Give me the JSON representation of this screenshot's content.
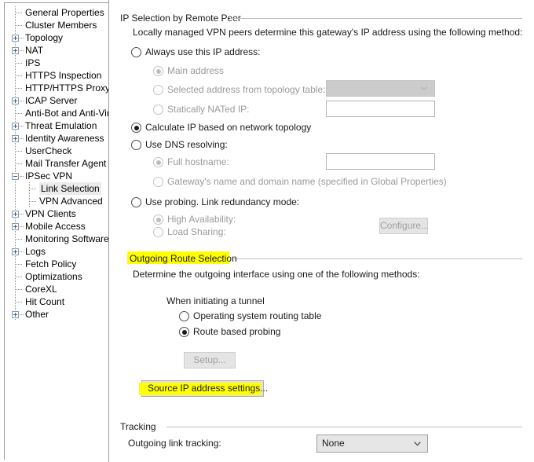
{
  "sidebar": {
    "items": [
      {
        "label": "General Properties",
        "indent": 0,
        "toggle": "none",
        "selected": false
      },
      {
        "label": "Cluster Members",
        "indent": 0,
        "toggle": "none",
        "selected": false
      },
      {
        "label": "Topology",
        "indent": 0,
        "toggle": "plus",
        "selected": false
      },
      {
        "label": "NAT",
        "indent": 0,
        "toggle": "plus",
        "selected": false
      },
      {
        "label": "IPS",
        "indent": 0,
        "toggle": "none",
        "selected": false
      },
      {
        "label": "HTTPS Inspection",
        "indent": 0,
        "toggle": "none",
        "selected": false
      },
      {
        "label": "HTTP/HTTPS Proxy",
        "indent": 0,
        "toggle": "none",
        "selected": false
      },
      {
        "label": "ICAP Server",
        "indent": 0,
        "toggle": "plus",
        "selected": false
      },
      {
        "label": "Anti-Bot and Anti-Virus",
        "indent": 0,
        "toggle": "none",
        "selected": false
      },
      {
        "label": "Threat Emulation",
        "indent": 0,
        "toggle": "plus",
        "selected": false
      },
      {
        "label": "Identity Awareness",
        "indent": 0,
        "toggle": "plus",
        "selected": false
      },
      {
        "label": "UserCheck",
        "indent": 0,
        "toggle": "none",
        "selected": false
      },
      {
        "label": "Mail Transfer Agent",
        "indent": 0,
        "toggle": "none",
        "selected": false
      },
      {
        "label": "IPSec VPN",
        "indent": 0,
        "toggle": "minus",
        "selected": false
      },
      {
        "label": "Link Selection",
        "indent": 1,
        "toggle": "none",
        "selected": true
      },
      {
        "label": "VPN Advanced",
        "indent": 1,
        "toggle": "none",
        "selected": false
      },
      {
        "label": "VPN Clients",
        "indent": 0,
        "toggle": "plus",
        "selected": false
      },
      {
        "label": "Mobile Access",
        "indent": 0,
        "toggle": "plus",
        "selected": false
      },
      {
        "label": "Monitoring Software bla",
        "indent": 0,
        "toggle": "none",
        "selected": false
      },
      {
        "label": "Logs",
        "indent": 0,
        "toggle": "plus",
        "selected": false
      },
      {
        "label": "Fetch Policy",
        "indent": 0,
        "toggle": "none",
        "selected": false
      },
      {
        "label": "Optimizations",
        "indent": 0,
        "toggle": "none",
        "selected": false
      },
      {
        "label": "CoreXL",
        "indent": 0,
        "toggle": "none",
        "selected": false
      },
      {
        "label": "Hit Count",
        "indent": 0,
        "toggle": "none",
        "selected": false
      },
      {
        "label": "Other",
        "indent": 0,
        "toggle": "plus",
        "selected": false
      }
    ]
  },
  "ip_selection": {
    "group_title": "IP Selection by Remote Peer",
    "description": "Locally managed VPN peers determine this gateway's IP address using the following method:",
    "always_use_ip": {
      "label": "Always use this IP address:",
      "checked": false,
      "enabled": true
    },
    "main_address": {
      "label": "Main address",
      "checked": true,
      "enabled": false
    },
    "selected_from_topology": {
      "label": "Selected address from topology table:",
      "checked": false,
      "enabled": false
    },
    "topology_combo": {
      "value": "",
      "enabled": false
    },
    "statically_nated": {
      "label": "Statically NATed IP:",
      "checked": false,
      "enabled": false
    },
    "nated_ip_field": {
      "value": "",
      "enabled": false
    },
    "calculate_ip": {
      "label": "Calculate IP based on network topology",
      "checked": true,
      "enabled": true
    },
    "use_dns": {
      "label": "Use DNS resolving:",
      "checked": false,
      "enabled": true
    },
    "full_hostname": {
      "label": "Full hostname:",
      "checked": true,
      "enabled": false
    },
    "full_hostname_field": {
      "value": "",
      "enabled": false
    },
    "gateway_name_domain": {
      "label": "Gateway's name and domain name (specified in Global Properties)",
      "checked": false,
      "enabled": false
    },
    "use_probing": {
      "label": "Use probing. Link redundancy mode:",
      "checked": false,
      "enabled": true
    },
    "high_availability": {
      "label": "High Availability:",
      "checked": true,
      "enabled": false
    },
    "load_sharing": {
      "label": "Load Sharing:",
      "checked": false,
      "enabled": false
    },
    "configure_button": {
      "label": "Configure...",
      "enabled": false
    }
  },
  "outgoing_route": {
    "group_title": "Outgoing Route Selection",
    "group_title_highlighted": true,
    "description": "Determine the outgoing interface using one of the following methods:",
    "when_initiating_label": "When initiating a tunnel",
    "os_routing_table": {
      "label": "Operating system routing table",
      "checked": false,
      "enabled": true
    },
    "route_based_probing": {
      "label": "Route based probing",
      "checked": true,
      "enabled": true
    },
    "setup_button": {
      "label": "Setup...",
      "enabled": false
    },
    "source_ip_button": {
      "label": "Source IP address settings...",
      "enabled": true,
      "highlighted": true
    }
  },
  "tracking": {
    "group_title": "Tracking",
    "outgoing_link_tracking_label": "Outgoing link tracking:",
    "outgoing_link_tracking_value": "None"
  },
  "colors": {
    "highlight": "#ffff00",
    "selection": "#ebebeb",
    "disabled_text": "#9a9a9a",
    "group_line": "#bfbfbf"
  }
}
